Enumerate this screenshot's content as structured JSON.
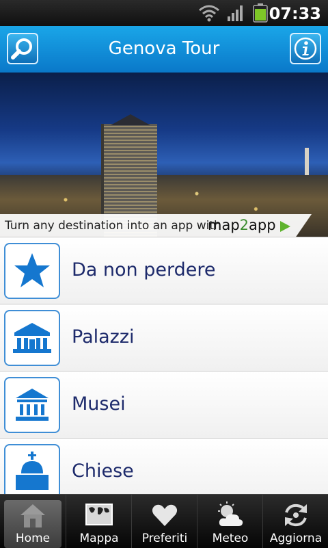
{
  "status_bar": {
    "time": "07:33"
  },
  "header": {
    "title": "Genova Tour"
  },
  "banner": {
    "ad_text": "Turn any destination into an app with",
    "brand_prefix": "map",
    "brand_mid": "2",
    "brand_suffix": "app"
  },
  "menu": [
    {
      "label": "Da non perdere",
      "icon": "star-icon"
    },
    {
      "label": "Palazzi",
      "icon": "palace-icon"
    },
    {
      "label": "Musei",
      "icon": "museum-icon"
    },
    {
      "label": "Chiese",
      "icon": "church-icon"
    }
  ],
  "tabs": [
    {
      "label": "Home",
      "icon": "home-icon",
      "active": true
    },
    {
      "label": "Mappa",
      "icon": "map-icon"
    },
    {
      "label": "Preferiti",
      "icon": "heart-icon"
    },
    {
      "label": "Meteo",
      "icon": "weather-icon"
    },
    {
      "label": "Aggiorna",
      "icon": "refresh-icon"
    }
  ],
  "colors": {
    "header_blue": "#0a78c9",
    "label_navy": "#1d2a6b",
    "icon_blue": "#1577cf"
  }
}
